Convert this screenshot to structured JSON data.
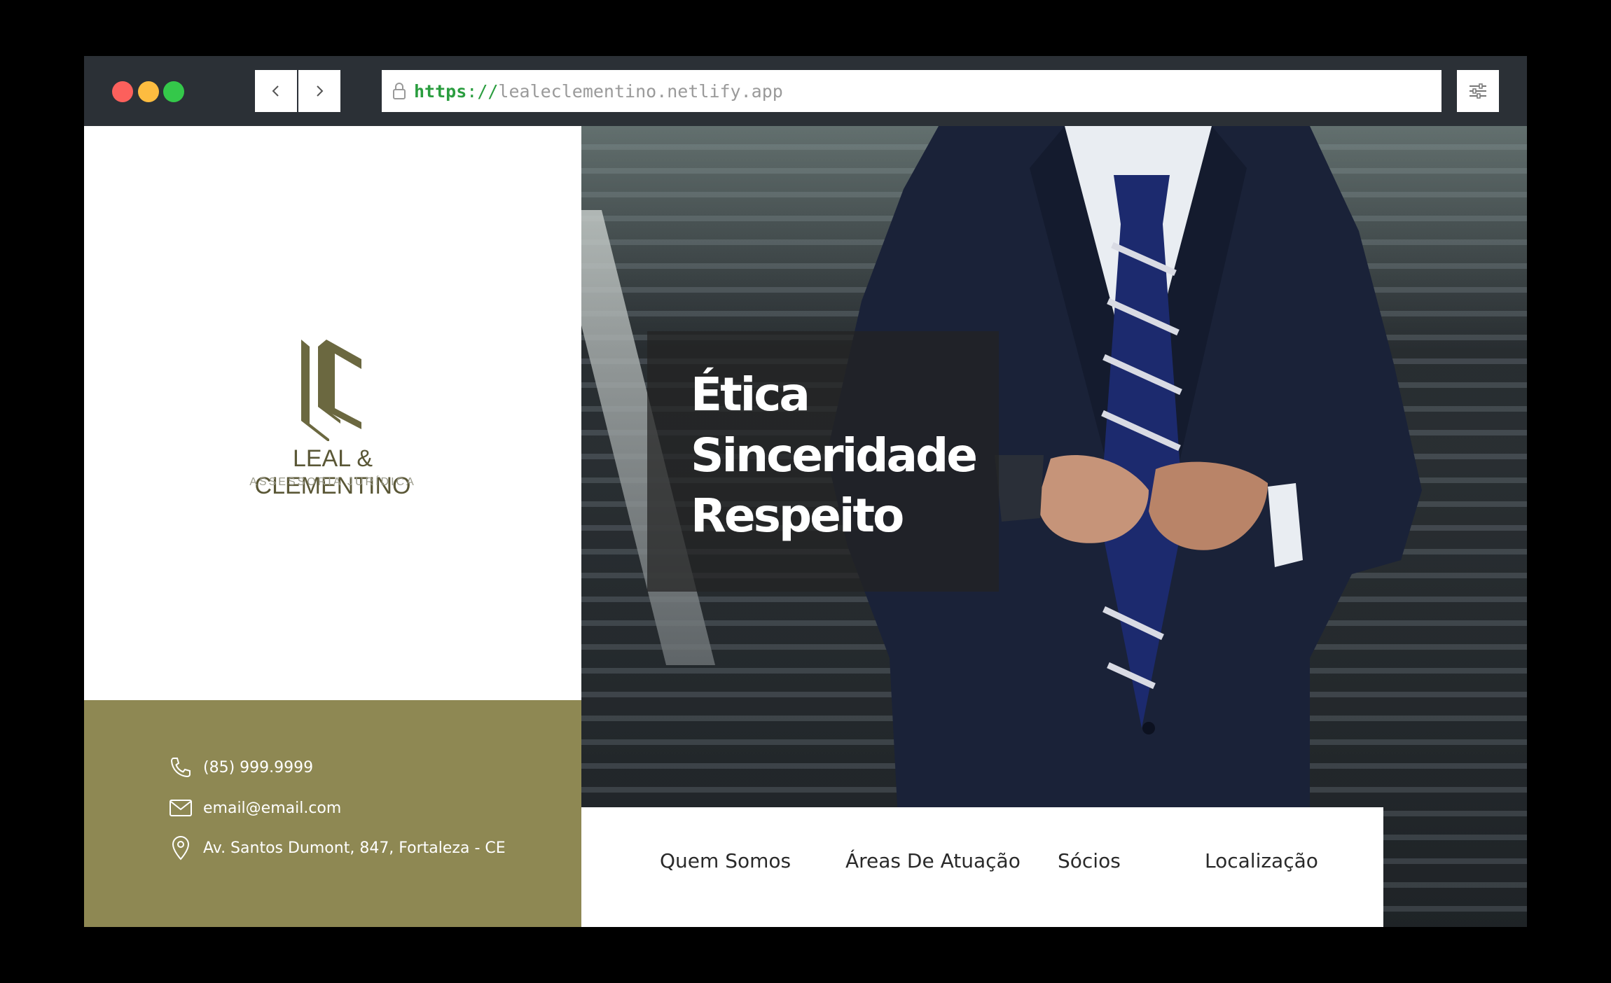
{
  "browser": {
    "url_scheme": "https",
    "url_separator": "://",
    "url_host": "lealeclementino.netlify.app"
  },
  "brand": {
    "name": "LEAL & CLEMENTINO",
    "tagline": "ASSESSORIA JURÍDICA",
    "color": "#6b6840"
  },
  "contact": {
    "phone": "(85) 999.9999",
    "email": "email@email.com",
    "address": "Av. Santos Dumont, 847, Fortaleza - CE"
  },
  "hero": {
    "values": [
      "Ética",
      "Sinceridade",
      "Respeito"
    ]
  },
  "nav": {
    "items": [
      "Quem Somos",
      "Áreas De Atuação",
      "Sócios",
      "Localização"
    ]
  },
  "icons": {
    "phone": "phone-icon",
    "email": "mail-icon",
    "address": "location-pin-icon",
    "social": "facebook-icon",
    "lock": "lock-icon",
    "settings": "sliders-icon"
  },
  "colors": {
    "olive": "#8e8853",
    "chrome": "#2b3036",
    "url_green": "#2a9d3f"
  }
}
